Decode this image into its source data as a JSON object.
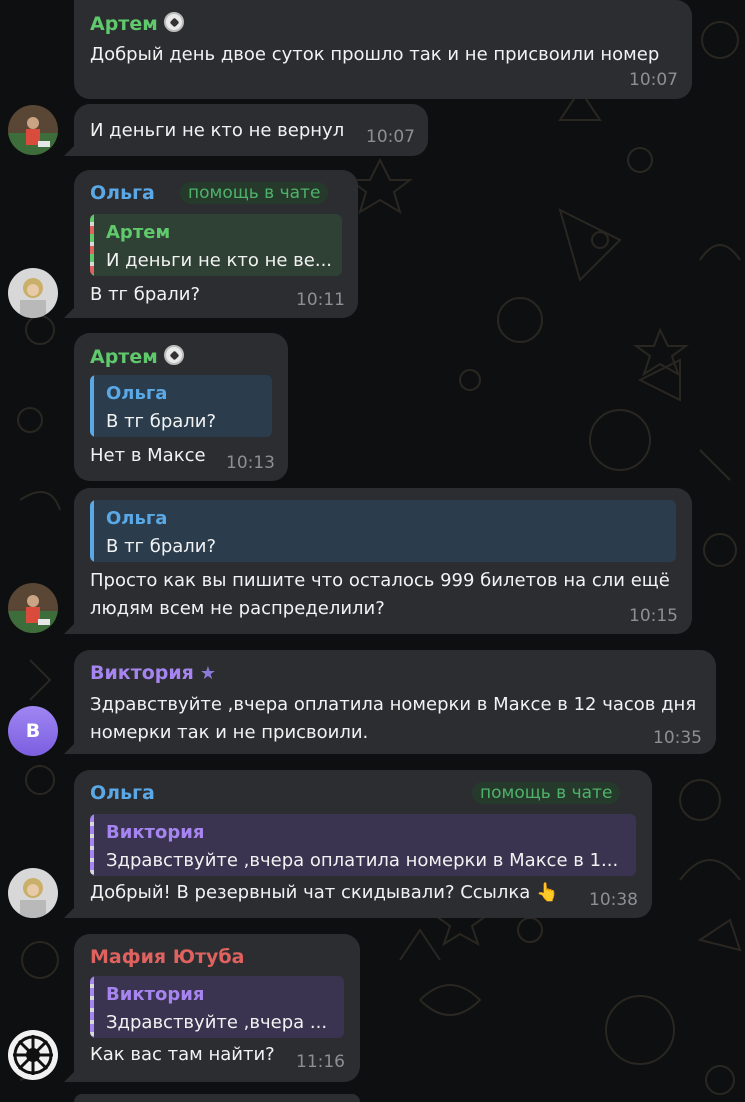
{
  "messages": [
    {
      "sender": "Артем",
      "text": "Добрый день двое суток прошло так и не присвоили номер",
      "time": "10:07"
    },
    {
      "text": "И деньги не кто не вернул",
      "time": "10:07"
    },
    {
      "sender": "Ольга",
      "badge": "помощь в чате",
      "quote": {
        "name": "Артем",
        "text": "И деньги не кто не ве..."
      },
      "text": "В тг брали?",
      "time": "10:11"
    },
    {
      "sender": "Артем",
      "quote": {
        "name": "Ольга",
        "text": "В тг брали?"
      },
      "text": "Нет в Максе",
      "time": "10:13"
    },
    {
      "quote": {
        "name": "Ольга",
        "text": "В тг брали?"
      },
      "lines": [
        "Просто как вы пишите что осталось 999 билетов на сли ещё",
        "людям всем не распределили?"
      ],
      "time": "10:15"
    },
    {
      "sender": "Виктория",
      "lines": [
        "Здравствуйте ,вчера оплатила номерки в Максе в 12 часов дня",
        "номерки так и не присвоили."
      ],
      "time": "10:35",
      "avatar_letter": "В"
    },
    {
      "sender": "Ольга",
      "badge": "помощь в чате",
      "quote": {
        "name": "Виктория",
        "text": "Здравствуйте ,вчера оплатила номерки в Максе в 1..."
      },
      "text": "Добрый! В резервный чат скидывали? Ссылка 👆",
      "time": "10:38"
    },
    {
      "sender": "Мафия Ютуба",
      "quote": {
        "name": "Виктория",
        "text": "Здравствуйте ,вчера ..."
      },
      "text": "Как вас там найти?",
      "time": "11:16"
    }
  ],
  "colors": {
    "background": "#0e0f10",
    "bubble": "#2b2d31",
    "name_artem": "#5fc96b",
    "name_olga": "#5aa9e6",
    "name_viktoria": "#a785f0",
    "name_mafia": "#e0625f",
    "badge_text": "#4fb26a",
    "time": "#8c8f95"
  },
  "icons": [
    "soccer-ball-icon",
    "star-icon",
    "pointing-up-emoji"
  ]
}
